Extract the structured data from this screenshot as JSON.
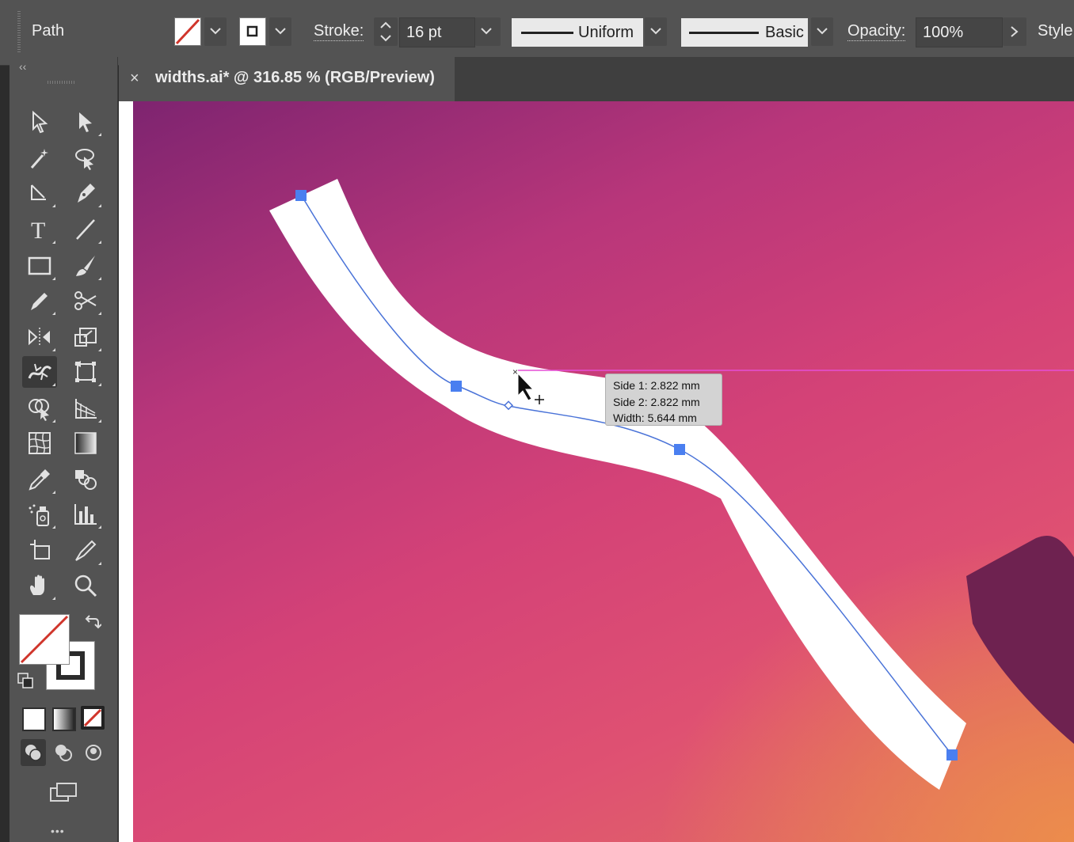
{
  "control_bar": {
    "selection_label": "Path",
    "stroke_label": "Stroke:",
    "stroke_weight": "16 pt",
    "width_profile": "Uniform",
    "brush": "Basic",
    "opacity_label": "Opacity:",
    "opacity_value": "100%",
    "style_label": "Style:"
  },
  "document_tab": {
    "close": "×",
    "title": "widths.ai* @ 316.85 % (RGB/Preview)"
  },
  "tools_panel": {
    "collapse": "‹‹",
    "more": "•••"
  },
  "width_tooltip": {
    "side1": "Side 1: 2.822 mm",
    "side2": "Side 2: 2.822 mm",
    "width": "Width: 5.644 mm"
  },
  "colors": {
    "anchor": "#4a7ff0",
    "path": "#4a73d8",
    "smart_guide": "#e64fd6",
    "stroke": "#ffffff"
  }
}
